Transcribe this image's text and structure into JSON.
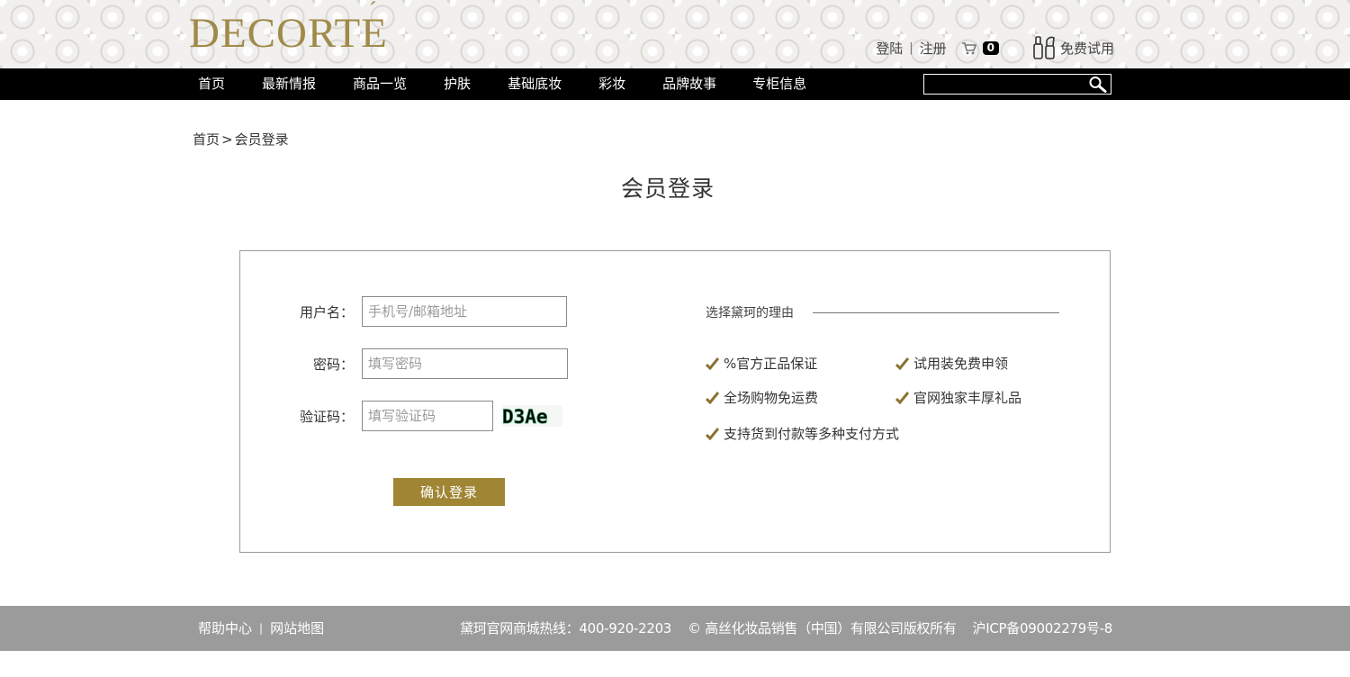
{
  "brand": {
    "logo_text": "DECORTE",
    "logo_accent": "´",
    "accent_color": "#a08a4a"
  },
  "header": {
    "login": "登陆",
    "separator": "|",
    "register": "注册",
    "cart_count": "0",
    "free_trial": "免费试用"
  },
  "nav": {
    "items": [
      {
        "label": "首页"
      },
      {
        "label": "最新情报"
      },
      {
        "label": "商品一览"
      },
      {
        "label": "护肤"
      },
      {
        "label": "基础底妆"
      },
      {
        "label": "彩妆"
      },
      {
        "label": "品牌故事"
      },
      {
        "label": "专柜信息"
      }
    ],
    "search_placeholder": ""
  },
  "breadcrumb": {
    "home": "首页",
    "sep": ">",
    "current": "会员登录"
  },
  "page_title": "会员登录",
  "login_form": {
    "username_label": "用户名：",
    "username_placeholder": "手机号/邮箱地址",
    "password_label": "密码：",
    "password_placeholder": "填写密码",
    "captcha_label": "验证码：",
    "captcha_placeholder": "填写验证码",
    "captcha_text": "D3Ae",
    "submit_label": "确认登录",
    "submit_color": "#a08535"
  },
  "reasons": {
    "title": "选择黛珂的理由",
    "items": [
      "%官方正品保证",
      "试用装免费申领",
      "全场购物免运费",
      "官网独家丰厚礼品",
      "支持货到付款等多种支付方式"
    ]
  },
  "footer": {
    "help": "帮助中心",
    "pipe": "|",
    "sitemap": "网站地图",
    "hotline": "黛珂官网商城热线：400-920-2203",
    "copyright": "© 高丝化妆品销售（中国）有限公司版权所有",
    "icp": "沪ICP备09002279号-8",
    "bg_color": "#9b9b9b"
  }
}
